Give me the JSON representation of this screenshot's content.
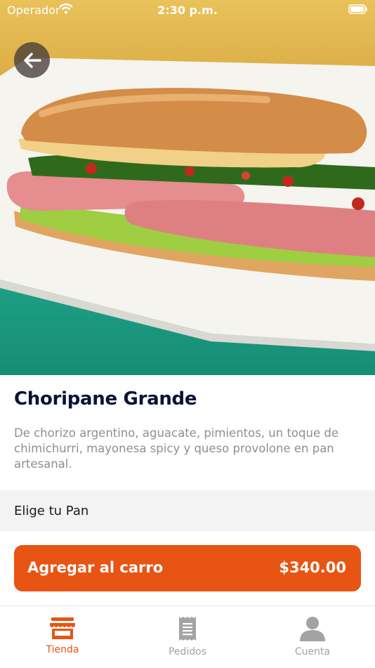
{
  "status_bar": {
    "carrier": "Operador",
    "time": "2:30 p.m."
  },
  "product": {
    "name": "Choripane Grande",
    "description": "De chorizo argentino, aguacate, pimientos, un toque de chimichurri, mayonesa spicy y queso provolone en pan artesanal."
  },
  "options": {
    "bread_label": "Elige tu Pan"
  },
  "cart": {
    "add_label": "Agregar al carro",
    "price": "$340.00"
  },
  "tabs": [
    {
      "label": "Tienda",
      "icon": "store-icon",
      "active": true
    },
    {
      "label": "Pedidos",
      "icon": "receipt-icon",
      "active": false
    },
    {
      "label": "Cuenta",
      "icon": "user-icon",
      "active": false
    }
  ],
  "colors": {
    "accent": "#e85413",
    "title": "#0b1236",
    "muted": "#8f8f8f",
    "tab_inactive": "#a3a3a3"
  }
}
